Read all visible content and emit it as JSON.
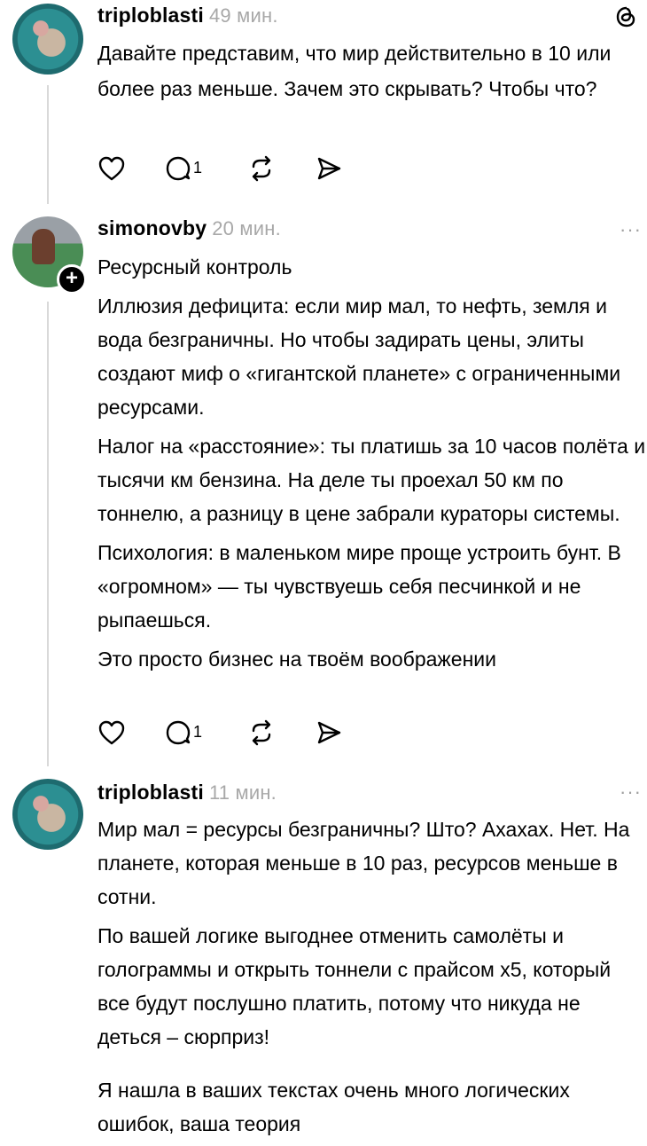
{
  "posts": [
    {
      "username": "triploblasti",
      "time": "49 мин.",
      "paragraphs": [
        "Давайте представим, что мир действительно в 10 или более раз меньше. Зачем это скрывать? Чтобы что?"
      ],
      "reply_count": "1"
    },
    {
      "username": "simonovby",
      "time": "20 мин.",
      "more": "···",
      "paragraphs": [
        "Ресурсный контроль",
        "Иллюзия дефицита: если мир мал, то нефть, земля и вода безграничны. Но чтобы задирать цены, элиты создают миф о «гигантской планете» с ограниченными ресурсами.",
        "Налог на «расстояние»: ты платишь за 10 часов полёта и тысячи км бензина. На деле ты проехал 50 км по тоннелю, а разницу в цене забрали кураторы системы.",
        "Психология: в маленьком мире проще устроить бунт. В «огромном» — ты чувствуешь себя песчинкой и не рыпаешься.",
        "Это просто бизнес на твоём воображении"
      ],
      "reply_count": "1",
      "follow_badge": "+"
    },
    {
      "username": "triploblasti",
      "time": "11 мин.",
      "more": "···",
      "paragraphs": [
        "Мир мал = ресурсы безграничны? Што? Ахахах. Нет. На планете, которая меньше в 10 раз, ресурсов меньше в сотни.",
        "По вашей логике выгоднее отменить самолёты и голограммы и открыть тоннели с прайсом x5, который все будут послушно платить, потому что никуда не деться – сюрприз!",
        "Я нашла в ваших текстах очень много логических ошибок, ваша теория"
      ]
    }
  ]
}
